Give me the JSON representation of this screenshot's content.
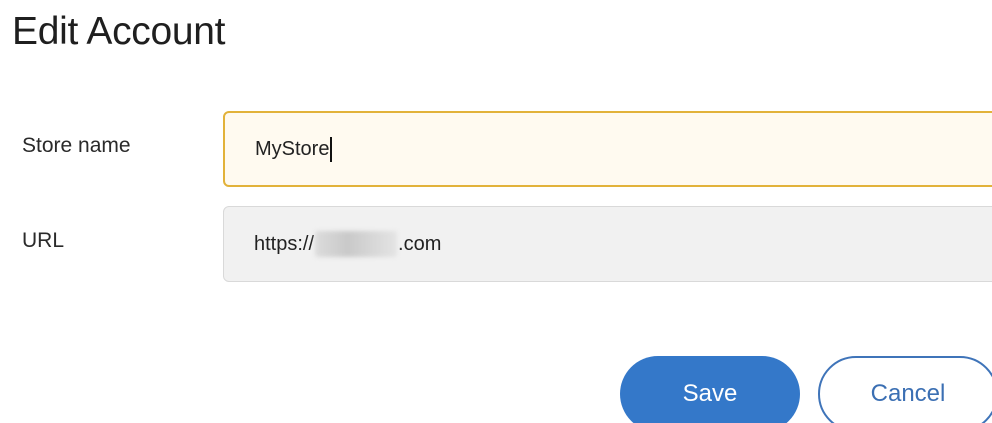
{
  "title": "Edit Account",
  "form": {
    "store_name": {
      "label": "Store name",
      "value": "MyStore"
    },
    "url": {
      "label": "URL",
      "prefix": "https://",
      "suffix": ".com"
    }
  },
  "actions": {
    "save_label": "Save",
    "cancel_label": "Cancel"
  },
  "colors": {
    "primary": "#3478c9",
    "focus_border": "#e2b23a",
    "readonly_bg": "#f1f1f1"
  }
}
